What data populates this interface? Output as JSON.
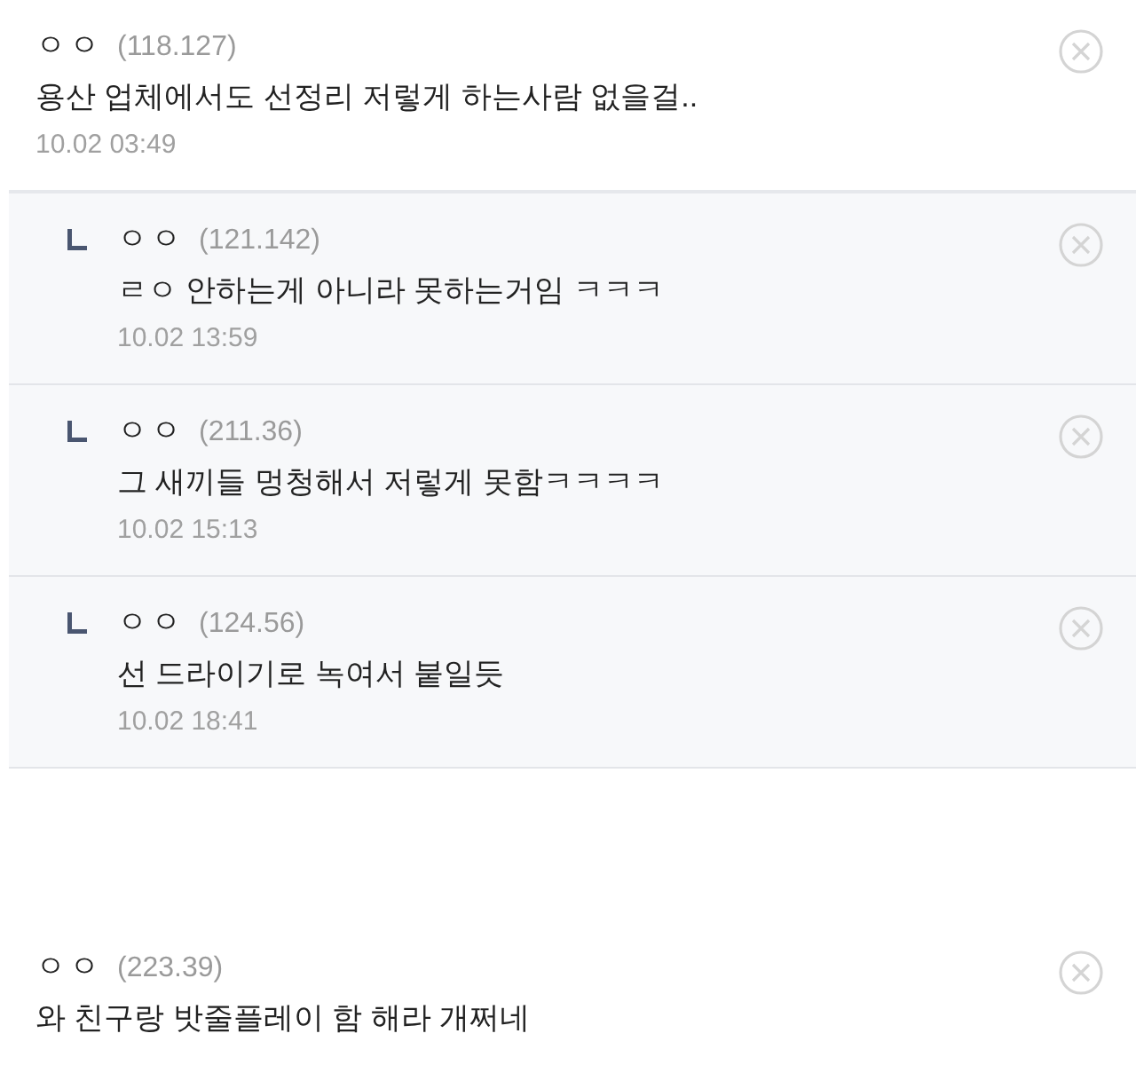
{
  "comments": [
    {
      "author": "ㅇㅇ",
      "ip": "(118.127)",
      "text": "용산 업체에서도 선정리 저렇게 하는사람 없을걸..",
      "date": "10.02 03:49",
      "children": [
        {
          "author": "ㅇㅇ",
          "ip": "(121.142)",
          "text": "ㄹㅇ 안하는게 아니라 못하는거임 ㅋㅋㅋ",
          "date": "10.02 13:59"
        },
        {
          "author": "ㅇㅇ",
          "ip": "(211.36)",
          "text": "그 새끼들 멍청해서 저렇게 못함ㅋㅋㅋㅋ",
          "date": "10.02 15:13"
        },
        {
          "author": "ㅇㅇ",
          "ip": "(124.56)",
          "text": "선 드라이기로 녹여서 붙일듯",
          "date": "10.02 18:41"
        }
      ]
    },
    {
      "author": "ㅇㅇ",
      "ip": "(223.39)",
      "text": "와 친구랑 밧줄플레이 함 해라 개쩌네"
    }
  ]
}
